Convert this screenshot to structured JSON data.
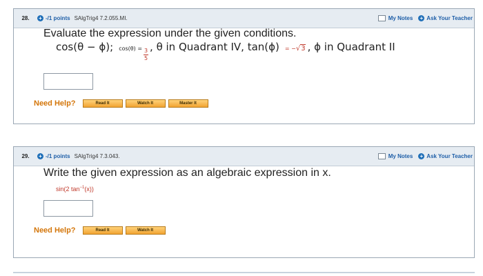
{
  "q28": {
    "number": "28.",
    "points": "-/1 points",
    "id": "SAlgTrig4 7.2.055.MI.",
    "my_notes": "My Notes",
    "ask_teacher": "Ask Your Teacher",
    "prompt": "Evaluate the expression under the given conditions.",
    "math": {
      "expr": "cos(θ − ϕ);",
      "cond1_lhs": "cos(θ) =",
      "frac_num": "3",
      "frac_den": "5",
      "cond1_tail": ", θ in Quadrant IV, tan(ϕ)",
      "cond2_eq": "= −",
      "sqrt_val": "3",
      "cond2_tail": ", ϕ in Quadrant II"
    },
    "need_help": "Need Help?",
    "buttons": [
      "Read It",
      "Watch It",
      "Master It"
    ]
  },
  "q29": {
    "number": "29.",
    "points": "-/1 points",
    "id": "SAlgTrig4 7.3.043.",
    "my_notes": "My Notes",
    "ask_teacher": "Ask Your Teacher",
    "prompt": "Write the given expression as an algebraic expression in x.",
    "expr_pre": "sin(2 tan",
    "expr_sup": "−1",
    "expr_post": "(x))",
    "need_help": "Need Help?",
    "buttons": [
      "Read It",
      "Watch It"
    ]
  },
  "colors": {
    "header_bg": "#e6ecf2",
    "link_blue": "#1f5fa8",
    "need_help_orange": "#d4760a",
    "button_orange": "#f2a432",
    "math_red": "#c0392b"
  }
}
